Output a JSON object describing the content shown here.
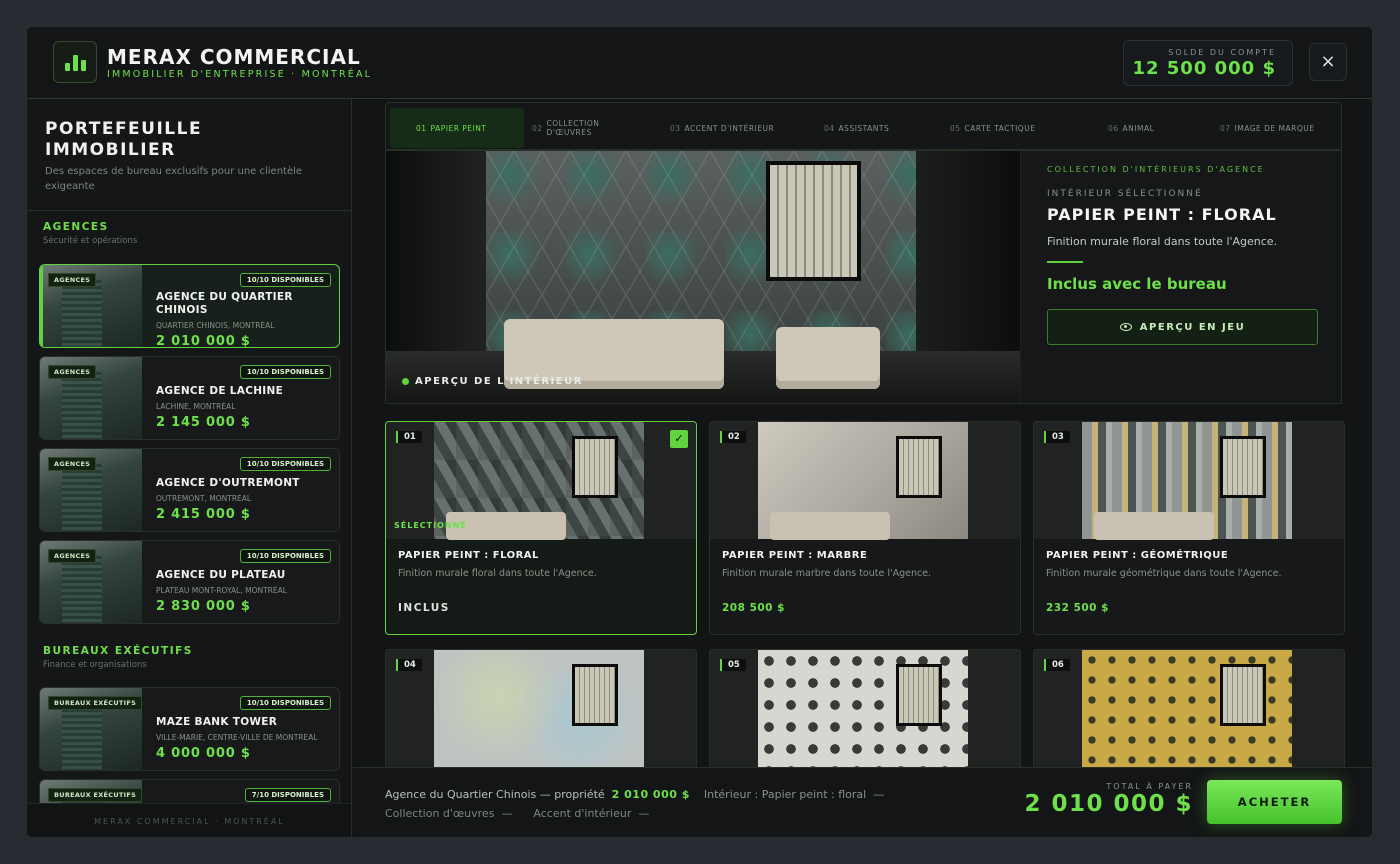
{
  "header": {
    "brand": "MERAX COMMERCIAL",
    "subtitle": "IMMOBILIER D'ENTREPRISE · MONTRÉAL",
    "balance_label": "SOLDE DU COMPTE",
    "balance_value": "12 500 000 $",
    "close_icon": "×"
  },
  "sidebar": {
    "title": "PORTEFEUILLE IMMOBILIER",
    "description": "Des espaces de bureau exclusifs pour une clientèle exigeante",
    "sections": [
      {
        "title": "AGENCES",
        "subtitle": "Sécurité et opérations"
      },
      {
        "title": "BUREAUX EXÉCUTIFS",
        "subtitle": "Finance et organisations"
      }
    ],
    "properties": [
      {
        "tag": "AGENCES",
        "availability": "10/10 DISPONIBLES",
        "name": "AGENCE DU QUARTIER CHINOIS",
        "location": "QUARTIER CHINOIS, MONTRÉAL",
        "price": "2 010 000 $"
      },
      {
        "tag": "AGENCES",
        "availability": "10/10 DISPONIBLES",
        "name": "AGENCE DE LACHINE",
        "location": "LACHINE, MONTRÉAL",
        "price": "2 145 000 $"
      },
      {
        "tag": "AGENCES",
        "availability": "10/10 DISPONIBLES",
        "name": "AGENCE D'OUTREMONT",
        "location": "OUTREMONT, MONTRÉAL",
        "price": "2 415 000 $"
      },
      {
        "tag": "AGENCES",
        "availability": "10/10 DISPONIBLES",
        "name": "AGENCE DU PLATEAU",
        "location": "PLATEAU MONT-ROYAL, MONTRÉAL",
        "price": "2 830 000 $"
      },
      {
        "tag": "BUREAUX EXÉCUTIFS",
        "availability": "10/10 DISPONIBLES",
        "name": "MAZE BANK TOWER",
        "location": "VILLE-MARIE, CENTRE-VILLE DE MONTRÉAL",
        "price": "4 000 000 $"
      },
      {
        "tag": "BUREAUX EXÉCUTIFS",
        "availability": "7/10 DISPONIBLES"
      }
    ],
    "footer": "MERAX COMMERCIAL · MONTRÉAL"
  },
  "tabs": [
    {
      "num": "01",
      "label": "PAPIER PEINT"
    },
    {
      "num": "02",
      "label": "COLLECTION D'ŒUVRES"
    },
    {
      "num": "03",
      "label": "ACCENT D'INTÉRIEUR"
    },
    {
      "num": "04",
      "label": "ASSISTANTS"
    },
    {
      "num": "05",
      "label": "CARTE TACTIQUE"
    },
    {
      "num": "06",
      "label": "ANIMAL"
    },
    {
      "num": "07",
      "label": "IMAGE DE MARQUE"
    }
  ],
  "hero": {
    "preview_label": "APERÇU DE L'INTÉRIEUR",
    "kicker": "COLLECTION D'INTÉRIEURS D'AGENCE",
    "selected_label": "INTÉRIEUR SÉLECTIONNÉ",
    "title": "PAPIER PEINT : FLORAL",
    "description": "Finition murale floral dans toute l'Agence.",
    "included": "Inclus avec le bureau",
    "preview_button": "APERÇU EN JEU"
  },
  "options": [
    {
      "num": "01",
      "name": "PAPIER PEINT : FLORAL",
      "desc": "Finition murale floral dans toute l'Agence.",
      "price": "INCLUS",
      "selected_label": "SÉLECTIONNÉ"
    },
    {
      "num": "02",
      "name": "PAPIER PEINT : MARBRE",
      "desc": "Finition murale marbre dans toute l'Agence.",
      "price": "208 500 $"
    },
    {
      "num": "03",
      "name": "PAPIER PEINT : GÉOMÉTRIQUE",
      "desc": "Finition murale géométrique dans toute l'Agence.",
      "price": "232 500 $"
    },
    {
      "num": "04"
    },
    {
      "num": "05"
    },
    {
      "num": "06"
    }
  ],
  "footer": {
    "property": "Agence du Quartier Chinois — propriété",
    "property_price": "2 010 000 $",
    "interior": "Intérieur : Papier peint : floral",
    "interior_value": "—",
    "collection": "Collection d'œuvres",
    "collection_value": "—",
    "accent": "Accent d'intérieur",
    "accent_value": "—",
    "total_label": "TOTAL À PAYER",
    "total_value": "2 010 000 $",
    "buy_button": "ACHETER"
  },
  "colors": {
    "accent": "#6ee04a",
    "background": "#121416",
    "card": "#18191b"
  }
}
